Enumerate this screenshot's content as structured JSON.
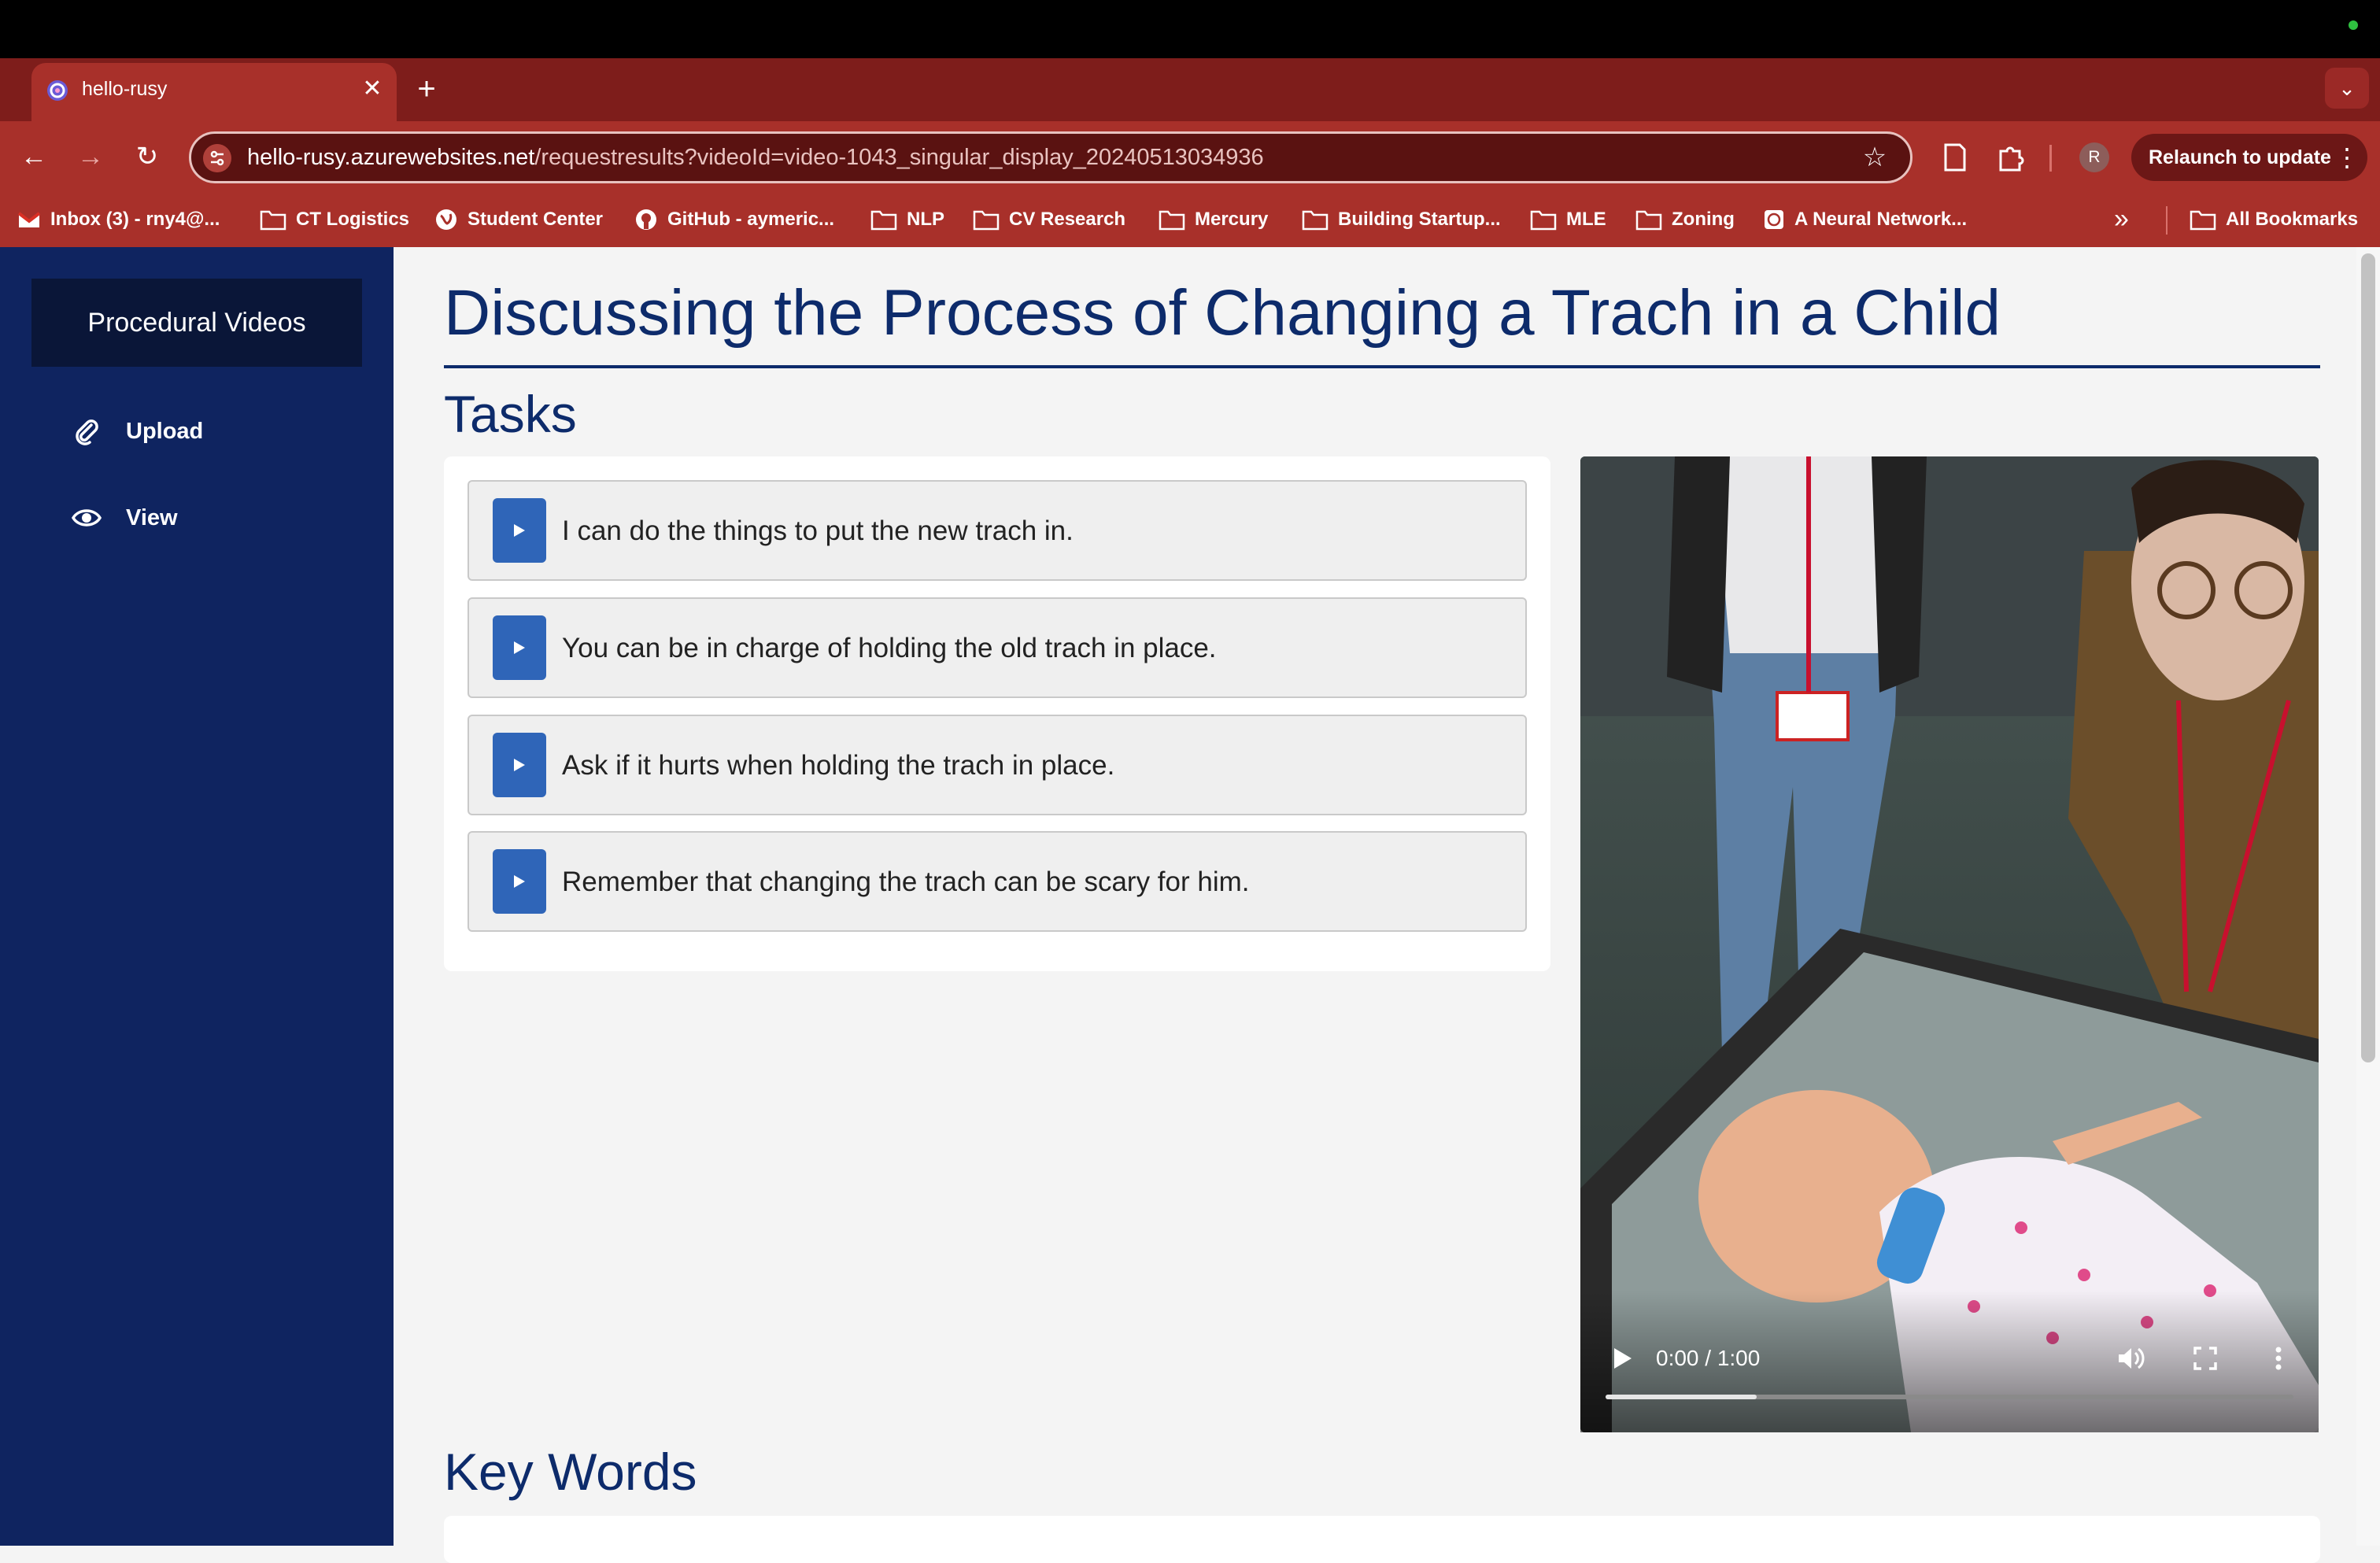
{
  "browser": {
    "tab_title": "hello-rusy",
    "tab_close": "✕",
    "new_tab": "+",
    "url_host": "hello-rusy.azurewebsites.net",
    "url_path": "/requestresults?videoId=video-1043_singular_display_20240513034936",
    "profile_initial": "R",
    "relaunch_label": "Relaunch to update",
    "bookmarks": [
      {
        "label": "Inbox (3) - rny4@...",
        "icon": "gmail-icon"
      },
      {
        "label": "CT Logistics",
        "icon": "folder-icon"
      },
      {
        "label": "Student Center",
        "icon": "globe-icon"
      },
      {
        "label": "GitHub - aymeric...",
        "icon": "github-icon"
      },
      {
        "label": "NLP",
        "icon": "folder-icon"
      },
      {
        "label": "CV Research",
        "icon": "folder-icon"
      },
      {
        "label": "Mercury",
        "icon": "folder-icon"
      },
      {
        "label": "Building Startup...",
        "icon": "folder-icon"
      },
      {
        "label": "MLE",
        "icon": "folder-icon"
      },
      {
        "label": "Zoning",
        "icon": "folder-icon"
      },
      {
        "label": "A Neural Network...",
        "icon": "site-icon"
      }
    ],
    "bookmarks_more": "»",
    "all_bookmarks": "All Bookmarks"
  },
  "sidebar": {
    "brand": "Procedural Videos",
    "items": [
      {
        "label": "Upload",
        "icon": "paperclip-icon"
      },
      {
        "label": "View",
        "icon": "eye-icon"
      }
    ]
  },
  "main": {
    "title": "Discussing the Process of Changing a Trach in a Child",
    "tasks_heading": "Tasks",
    "tasks": [
      "I can do the things to put the new trach in.",
      "You can be in charge of holding the old trach in place.",
      "Ask if it hurts when holding the trach in place.",
      "Remember that changing the trach can be scary for him."
    ],
    "key_words_heading": "Key Words",
    "video": {
      "time": "0:00 / 1:00",
      "buffered_fraction": 0.22
    }
  },
  "colors": {
    "browser_frame": "#a8302a",
    "sidebar": "#0f2460",
    "heading": "#0d2b6b",
    "task_button": "#2f65b8"
  }
}
